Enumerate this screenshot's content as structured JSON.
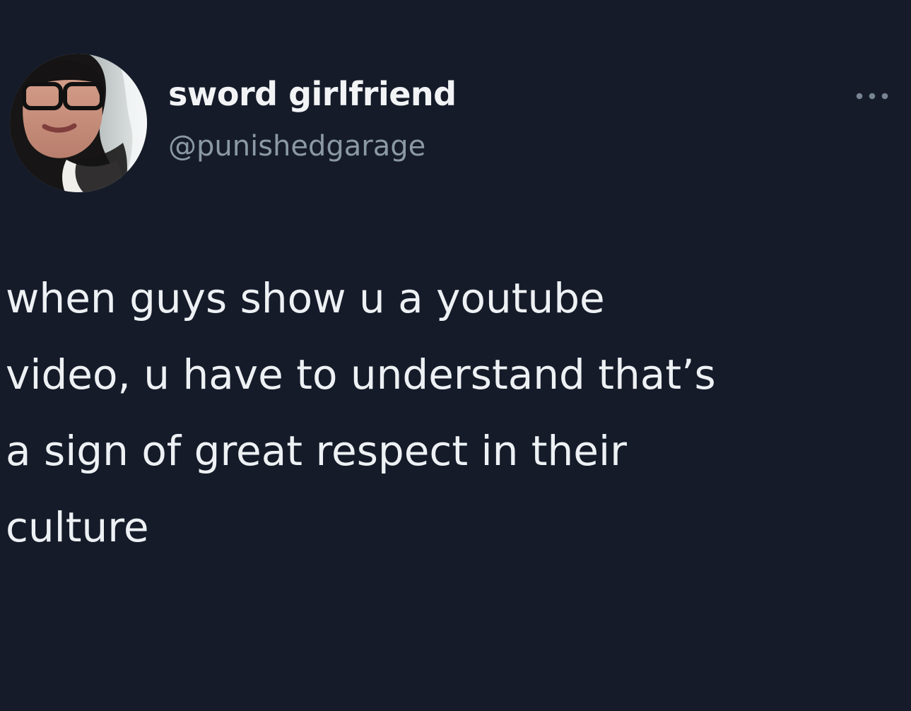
{
  "author": {
    "display_name": "sword girlfriend",
    "handle": "@punishedgarage"
  },
  "tweet": {
    "text": "when guys show u a youtube\nvideo, u have to understand that’s\na sign of great respect in their\nculture"
  },
  "icons": {
    "avatar": "avatar-photo",
    "more": "more-icon"
  },
  "colors": {
    "background": "#151b29",
    "primary_text": "#eef1f4",
    "secondary_text": "#8b98a5"
  }
}
